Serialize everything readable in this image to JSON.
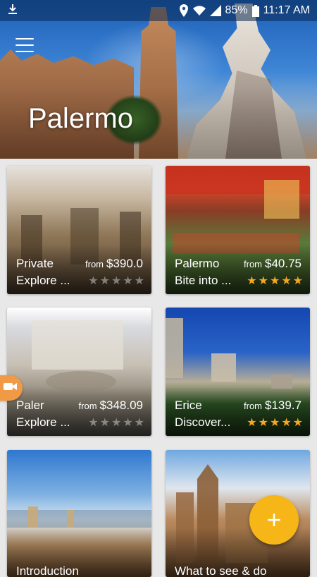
{
  "status_bar": {
    "battery": "85%",
    "time": "11:17 AM",
    "icons": [
      "download-icon",
      "location-icon",
      "wifi-icon",
      "signal-icon",
      "battery-icon"
    ]
  },
  "header": {
    "title": "Palermo",
    "menu_icon": "hamburger-menu-icon"
  },
  "cards": [
    {
      "title": "Private",
      "subtitle": "Explore ...",
      "price_prefix": "from",
      "price": "$390.0",
      "rating": 0
    },
    {
      "title": "Palermo",
      "subtitle": "Bite into ...",
      "price_prefix": "from",
      "price": "$40.75",
      "rating": 5
    },
    {
      "title": "Paler",
      "subtitle": "Explore ...",
      "price_prefix": "from",
      "price": "$348.09",
      "rating": 0
    },
    {
      "title": "Erice",
      "subtitle": "Discover...",
      "price_prefix": "from",
      "price": "$139.7",
      "rating": 5
    },
    {
      "title": "Introduction",
      "subtitle": "",
      "price_prefix": "",
      "price": "",
      "rating": null
    },
    {
      "title": "What to see & do",
      "subtitle": "",
      "price_prefix": "",
      "price": "",
      "rating": null
    }
  ],
  "fab": {
    "label": "+",
    "icon": "plus-icon"
  },
  "colors": {
    "fab": "#f7b618",
    "star": "#f5a623",
    "chip": "#f19a45"
  }
}
